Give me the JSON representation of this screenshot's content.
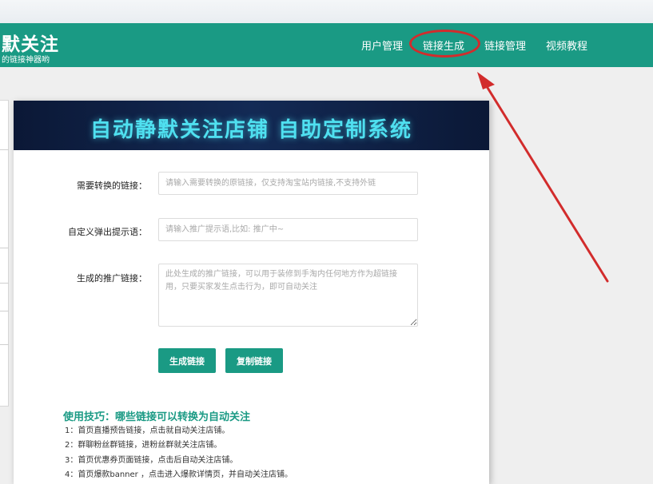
{
  "header": {
    "logo_title": "默关注",
    "logo_subtitle": "的链接神器哟",
    "nav": [
      {
        "label": "用户管理"
      },
      {
        "label": "链接生成"
      },
      {
        "label": "链接管理"
      },
      {
        "label": "视频教程"
      }
    ],
    "annotation_color": "#d22c2c",
    "accent_color": "#1a9a84"
  },
  "banner": {
    "title": "自动静默关注店铺 自助定制系统"
  },
  "form": {
    "link_label": "需要转换的链接：",
    "link_placeholder": "请输入需要转换的原链接，仅支持淘宝站内链接,不支持外链",
    "tip_label": "自定义弹出提示语：",
    "tip_placeholder": "请输入推广提示语,比如: 推广中~",
    "result_label": "生成的推广链接：",
    "result_placeholder": "此处生成的推广链接，可以用于装修到手淘内任何地方作为超链接用，只要买家发生点击行为，即可自动关注"
  },
  "buttons": {
    "generate": "生成链接",
    "copy": "复制链接"
  },
  "tips": {
    "title": "使用技巧：哪些链接可以转换为自动关注",
    "items": [
      "1：首页直播预告链接，点击就自动关注店铺。",
      "2：群聊粉丝群链接，进粉丝群就关注店铺。",
      "3：首页优惠券页面链接，点击后自动关注店铺。",
      "4：首页爆款banner ，点击进入爆款详情页，并自动关注店铺。"
    ]
  }
}
